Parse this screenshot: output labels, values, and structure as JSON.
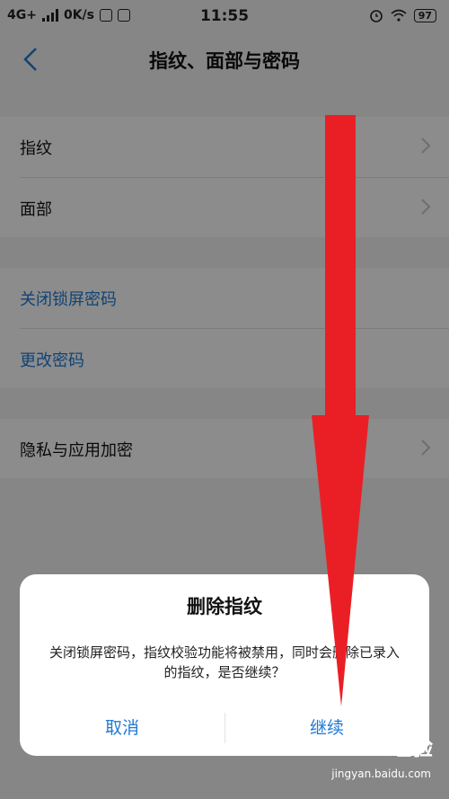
{
  "status_bar": {
    "network": "4G+",
    "speed": "0K/s",
    "time": "11:55",
    "battery": "97"
  },
  "header": {
    "title": "指纹、面部与密码"
  },
  "settings": {
    "group1": [
      "指纹",
      "面部"
    ],
    "group2": [
      "关闭锁屏密码",
      "更改密码"
    ],
    "group3": [
      "隐私与应用加密"
    ]
  },
  "dialog": {
    "title": "删除指纹",
    "message": "关闭锁屏密码，指纹校验功能将被禁用，同时会删除已录入的指纹，是否继续？",
    "cancel": "取消",
    "confirm": "继续"
  },
  "watermark": {
    "main": "Baidu经验",
    "sub": "jingyan.baidu.com"
  },
  "colors": {
    "accent": "#1f7ad6",
    "arrow": "#ea1f26"
  }
}
